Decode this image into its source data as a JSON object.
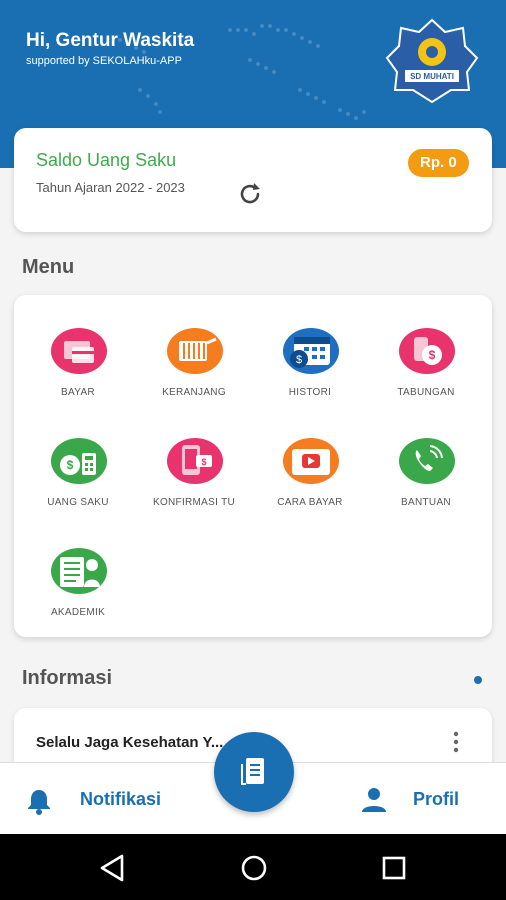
{
  "header": {
    "greeting": "Hi, Gentur Waskita",
    "supported_by": "supported by SEKOLAHku-APP",
    "logo_text": "SD MUHATI",
    "bg_color": "#1a6fb2"
  },
  "saldo": {
    "title": "Saldo Uang Saku",
    "year": "Tahun Ajaran 2022 - 2023",
    "amount": "Rp. 0",
    "refresh_icon": "refresh-icon"
  },
  "menu": {
    "heading": "Menu",
    "items": [
      {
        "label": "BAYAR",
        "icon": "payment-icon",
        "color": "#e8336d"
      },
      {
        "label": "KERANJANG",
        "icon": "cart-icon",
        "color": "#f57c1f"
      },
      {
        "label": "HISTORI",
        "icon": "calendar-history-icon",
        "color": "#1e6fc0"
      },
      {
        "label": "TABUNGAN",
        "icon": "savings-icon",
        "color": "#e8336d"
      },
      {
        "label": "UANG SAKU",
        "icon": "wallet-icon",
        "color": "#3aa84a"
      },
      {
        "label": "KONFIRMASI TU",
        "icon": "phone-confirm-icon",
        "color": "#e8336d"
      },
      {
        "label": "CARA BAYAR",
        "icon": "video-play-icon",
        "color": "#f57c1f"
      },
      {
        "label": "BANTUAN",
        "icon": "phone-call-icon",
        "color": "#3aa84a"
      },
      {
        "label": "AKADEMIK",
        "icon": "academic-doc-icon",
        "color": "#3aa84a"
      }
    ]
  },
  "info": {
    "heading": "Informasi",
    "first_item": "Selalu Jaga Kesehatan Y..."
  },
  "bottom_nav": {
    "notif_label": "Notifikasi",
    "profil_label": "Profil"
  }
}
